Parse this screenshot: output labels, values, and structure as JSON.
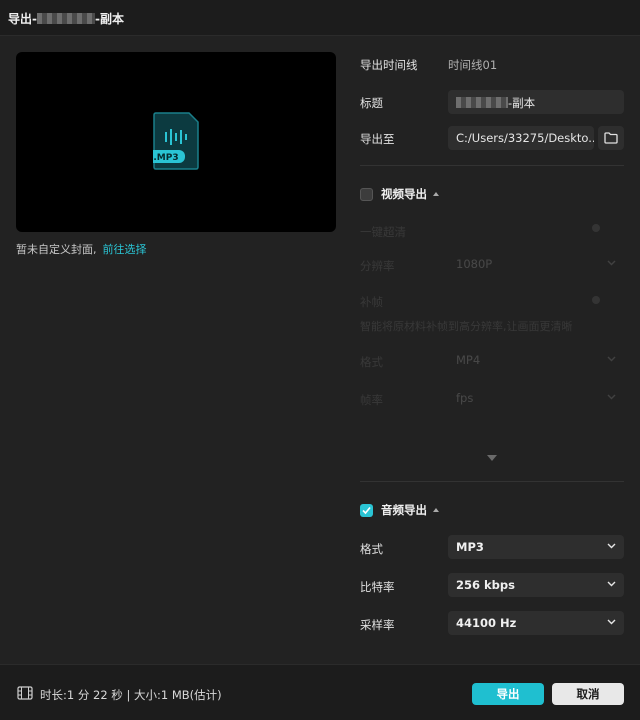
{
  "window": {
    "title_prefix": "导出-",
    "title_suffix": "-副本"
  },
  "preview": {
    "file_badge": ".MP3",
    "cover_hint": "暂未自定义封面,",
    "cover_link": "前往选择"
  },
  "settings": {
    "timeline_label": "导出时间线",
    "timeline_value": "时间线01",
    "title_label": "标题",
    "title_suffix": "-副本",
    "export_to_label": "导出至",
    "export_path": "C:/Users/33275/Deskto..."
  },
  "video": {
    "checked": false,
    "header": "视频导出",
    "one_click_label": "一键超清",
    "resolution_label": "分辨率",
    "resolution_value": "1080P",
    "frame_interp_label": "补帧",
    "hint": "智能将原材料补帧到高分辨率,让画面更清晰",
    "format_label": "格式",
    "format_value": "MP4",
    "fps_label": "帧率",
    "fps_value": "fps"
  },
  "audio": {
    "checked": true,
    "header": "音频导出",
    "format_label": "格式",
    "format_value": "MP3",
    "bitrate_label": "比特率",
    "bitrate_value": "256 kbps",
    "samplerate_label": "采样率",
    "samplerate_value": "44100 Hz"
  },
  "footer": {
    "info": "时长:1 分 22 秒 | 大小:1 MB(估计)",
    "export_button": "导出",
    "cancel_button": "取消"
  },
  "colors": {
    "accent": "#1fbfd0",
    "background": "#222222"
  }
}
